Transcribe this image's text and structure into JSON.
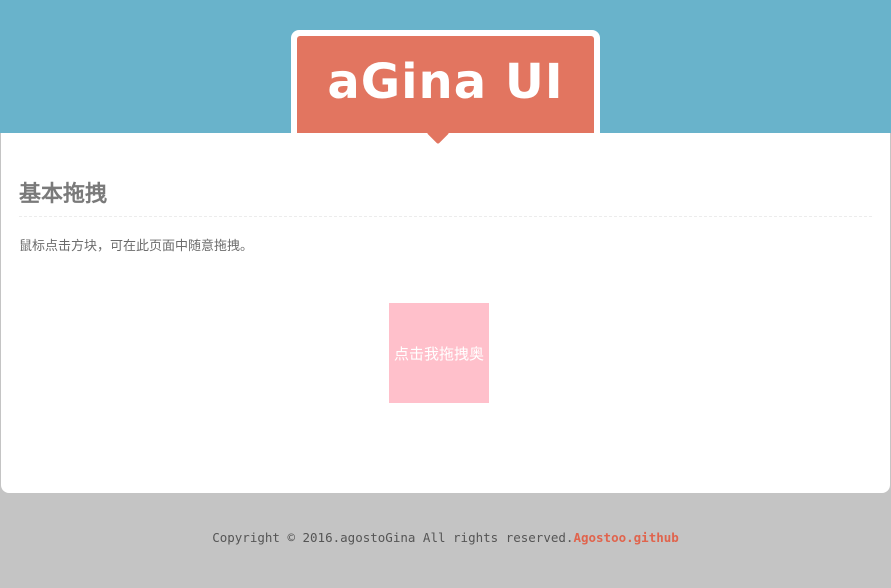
{
  "header": {
    "logo_text": "aGina UI"
  },
  "main": {
    "section_title": "基本拖拽",
    "description": "鼠标点击方块，可在此页面中随意拖拽。",
    "drag_box_label": "点击我拖拽奥"
  },
  "footer": {
    "copyright": "Copyright © 2016.agostoGina All rights reserved.",
    "link_text": "Agostoo.github"
  },
  "colors": {
    "header_band": "#69b3cb",
    "logo_background": "#e27560",
    "drag_box": "#ffc0cb",
    "page_background": "#c4c4c4",
    "link": "#e0644d"
  }
}
